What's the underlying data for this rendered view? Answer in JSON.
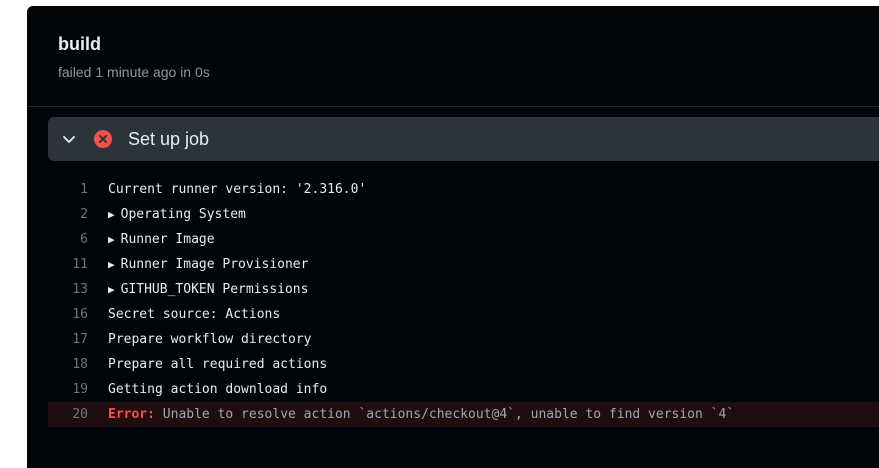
{
  "job": {
    "title": "build",
    "status": "failed 1 minute ago in 0s"
  },
  "step": {
    "name": "Set up job",
    "status_icon": "x-circle-fill-icon",
    "expand_icon": "chevron-down-icon",
    "status_color": "#f85149"
  },
  "log": {
    "lines": [
      {
        "n": "1",
        "text": "Current runner version: '2.316.0'",
        "collapsible": false
      },
      {
        "n": "2",
        "text": "Operating System",
        "collapsible": true
      },
      {
        "n": "6",
        "text": "Runner Image",
        "collapsible": true
      },
      {
        "n": "11",
        "text": "Runner Image Provisioner",
        "collapsible": true
      },
      {
        "n": "13",
        "text": "GITHUB_TOKEN Permissions",
        "collapsible": true
      },
      {
        "n": "16",
        "text": "Secret source: Actions",
        "collapsible": false
      },
      {
        "n": "17",
        "text": "Prepare workflow directory",
        "collapsible": false
      },
      {
        "n": "18",
        "text": "Prepare all required actions",
        "collapsible": false
      },
      {
        "n": "19",
        "text": "Getting action download info",
        "collapsible": false
      }
    ],
    "error": {
      "n": "20",
      "label": "Error:",
      "message": " Unable to resolve action `actions/checkout@4`, unable to find version `4`"
    },
    "toggle_glyph": "▶"
  }
}
